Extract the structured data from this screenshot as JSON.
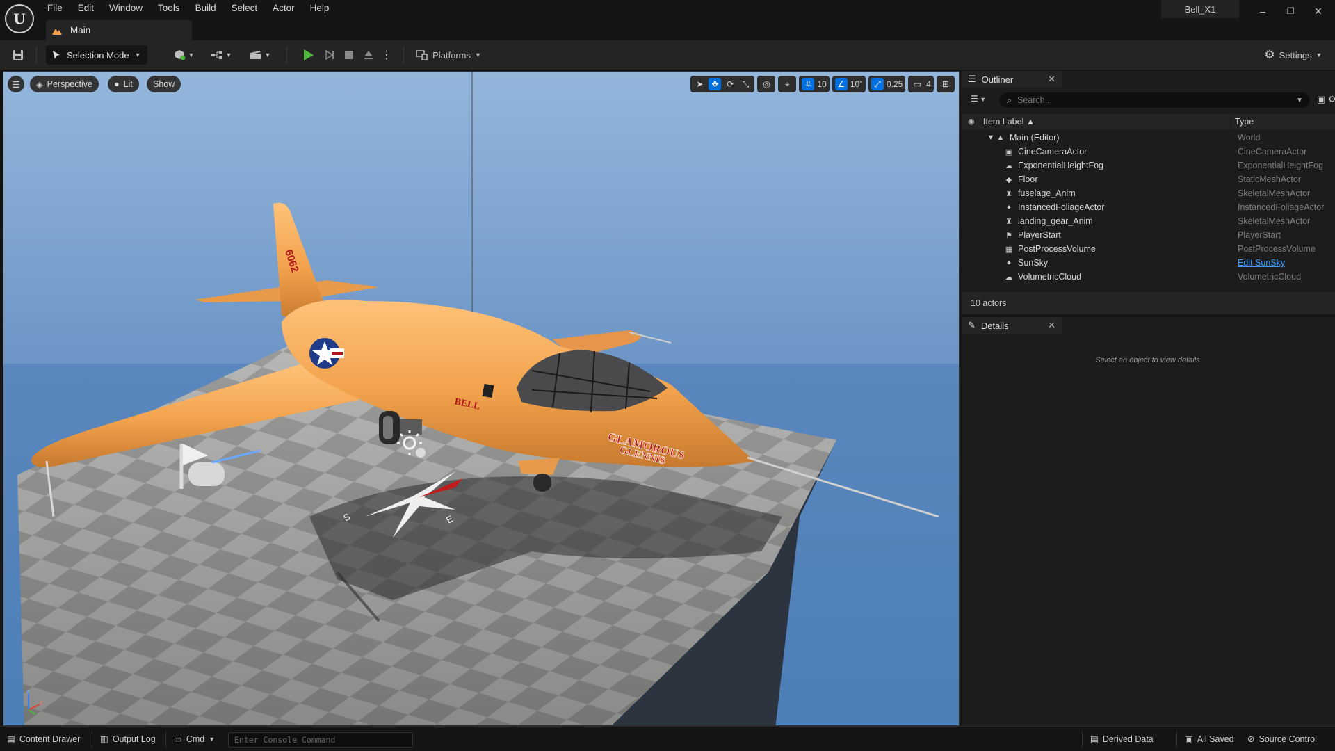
{
  "titlebar": {
    "menu": [
      "File",
      "Edit",
      "Window",
      "Tools",
      "Build",
      "Select",
      "Actor",
      "Help"
    ],
    "doc_tab": "Main",
    "project_name": "Bell_X1",
    "window_controls": {
      "minimize": "–",
      "restore": "❐",
      "close": "✕"
    }
  },
  "toolbar": {
    "selection_mode": "Selection Mode",
    "platforms": "Platforms",
    "settings": "Settings",
    "play_color": "#4fb83b"
  },
  "viewport": {
    "perspective": "Perspective",
    "lit": "Lit",
    "show": "Show",
    "grid_snap": "10",
    "rotation_snap": "10°",
    "scale_snap": "0.25",
    "camera_speed": "4",
    "aircraft_text": {
      "tail_number": "6062",
      "maker": "BELL",
      "nose_art_line1": "GLAMOROUS",
      "nose_art_line2": "GLENNIS"
    },
    "compass": {
      "east": "E",
      "south": "S"
    },
    "gizmo": {
      "z": "z",
      "x": "x"
    }
  },
  "outliner": {
    "tab_label": "Outliner",
    "search_placeholder": "Search...",
    "col_label": "Item Label",
    "col_type": "Type",
    "root": {
      "label": "Main (Editor)",
      "type": "World"
    },
    "items": [
      {
        "label": "CineCameraActor",
        "type": "CineCameraActor",
        "icon": "camera-icon"
      },
      {
        "label": "ExponentialHeightFog",
        "type": "ExponentialHeightFog",
        "icon": "fog-icon"
      },
      {
        "label": "Floor",
        "type": "StaticMeshActor",
        "icon": "mesh-icon"
      },
      {
        "label": "fuselage_Anim",
        "type": "SkeletalMeshActor",
        "icon": "skeleton-icon"
      },
      {
        "label": "InstancedFoliageActor",
        "type": "InstancedFoliageActor",
        "icon": "foliage-icon"
      },
      {
        "label": "landing_gear_Anim",
        "type": "SkeletalMeshActor",
        "icon": "skeleton-icon"
      },
      {
        "label": "PlayerStart",
        "type": "PlayerStart",
        "icon": "flag-icon"
      },
      {
        "label": "PostProcessVolume",
        "type": "PostProcessVolume",
        "icon": "volume-icon"
      },
      {
        "label": "SunSky",
        "type": "Edit SunSky",
        "icon": "sun-icon"
      },
      {
        "label": "VolumetricCloud",
        "type": "VolumetricCloud",
        "icon": "cloud-icon"
      }
    ],
    "actor_count": "10 actors"
  },
  "details": {
    "tab_label": "Details",
    "empty_message": "Select an object to view details."
  },
  "statusbar": {
    "content_drawer": "Content Drawer",
    "output_log": "Output Log",
    "cmd": "Cmd",
    "console_placeholder": "Enter Console Command",
    "derived_data": "Derived Data",
    "all_saved": "All Saved",
    "source_control": "Source Control"
  },
  "colors": {
    "accent": "#0070e0",
    "aircraft": "#f2a24c",
    "link": "#3c9bff"
  }
}
